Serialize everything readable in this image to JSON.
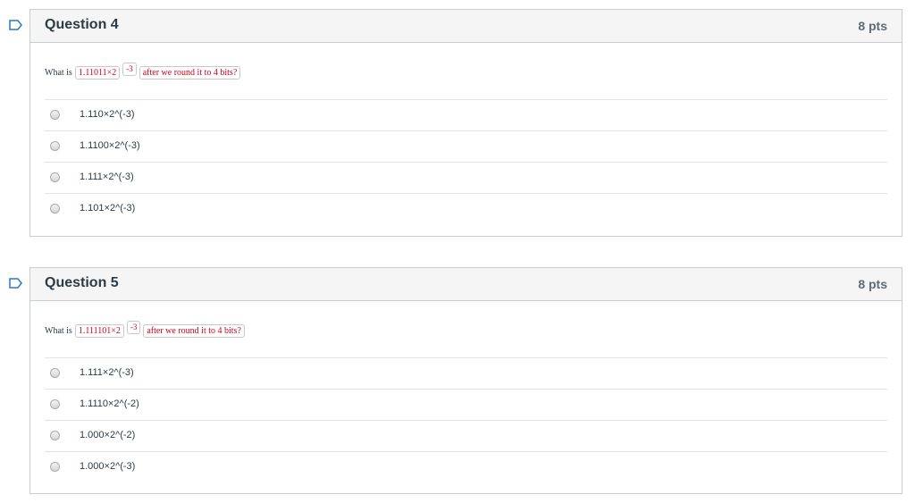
{
  "questions": [
    {
      "title": "Question 4",
      "points": "8 pts",
      "prompt": {
        "prefix": "What is",
        "mantissa": "1.11011×2",
        "exponent": "-3",
        "suffix": "after we round it to 4 bits?"
      },
      "answers": [
        "1.110×2^(-3)",
        "1.1100×2^(-3)",
        "1.111×2^(-3)",
        "1.101×2^(-3)"
      ]
    },
    {
      "title": "Question 5",
      "points": "8 pts",
      "prompt": {
        "prefix": "What is",
        "mantissa": "1.111101×2",
        "exponent": "-3",
        "suffix": "after we round it to 4 bits?"
      },
      "answers": [
        "1.111×2^(-3)",
        "1.1110×2^(-2)",
        "1.000×2^(-2)",
        "1.000×2^(-3)"
      ]
    }
  ],
  "colors": {
    "flag": "#2a7abf",
    "prompt_highlight": "#d0021b",
    "header_bg": "#f5f5f5"
  },
  "icons": {
    "flag": "flag-icon",
    "radio": "radio-unselected"
  }
}
